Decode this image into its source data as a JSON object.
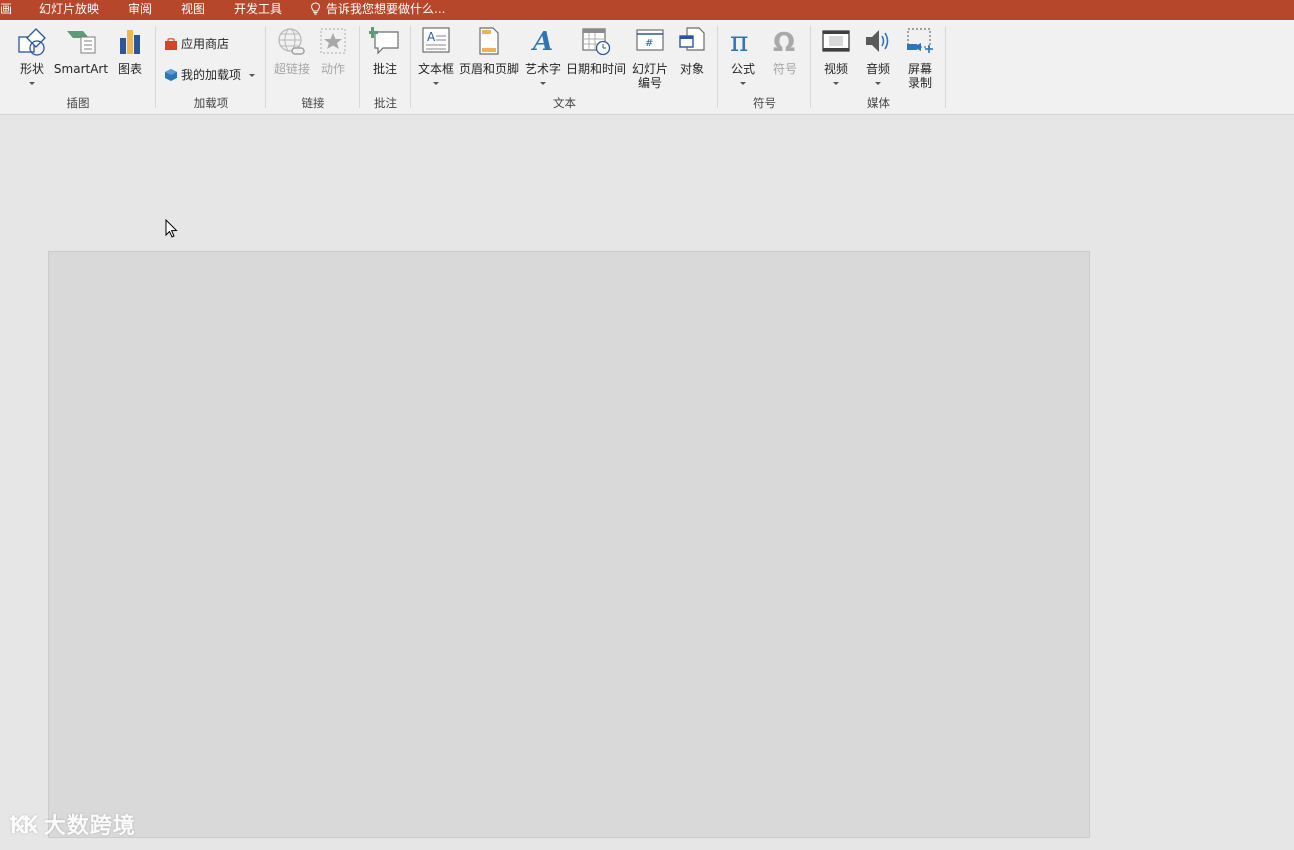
{
  "tabbar": {
    "tabs": [
      "画",
      "幻灯片放映",
      "审阅",
      "视图",
      "开发工具"
    ],
    "tell_me": "告诉我您想要做什么..."
  },
  "ribbon": {
    "groups": {
      "illustrations": {
        "label": "插图",
        "shapes": "形状",
        "smartart": "SmartArt",
        "chart": "图表"
      },
      "addins": {
        "label": "加载项",
        "store": "应用商店",
        "my_addins": "我的加载项"
      },
      "links": {
        "label": "链接",
        "hyperlink": "超链接",
        "action": "动作"
      },
      "comments": {
        "label": "批注",
        "comment": "批注"
      },
      "text": {
        "label": "文本",
        "textbox": "文本框",
        "header_footer": "页眉和页脚",
        "wordart": "艺术字",
        "date_time": "日期和时间",
        "slide_number": "幻灯片\n编号",
        "object": "对象"
      },
      "symbols": {
        "label": "符号",
        "equation": "公式",
        "symbol": "符号"
      },
      "media": {
        "label": "媒体",
        "video": "视频",
        "audio": "音频",
        "screen_recording": "屏幕\n录制"
      }
    }
  },
  "watermark": {
    "mark": "ꝄꝄ",
    "text": "大数跨境"
  },
  "colors": {
    "title_bar": "#b7472a",
    "ribbon_bg": "#f1f1f1",
    "workspace_bg": "#e6e6e6",
    "slide_bg": "#d9d9d9",
    "icon_blue": "#2b579a",
    "icon_orange": "#d24726",
    "icon_green": "#5b9b7a"
  }
}
